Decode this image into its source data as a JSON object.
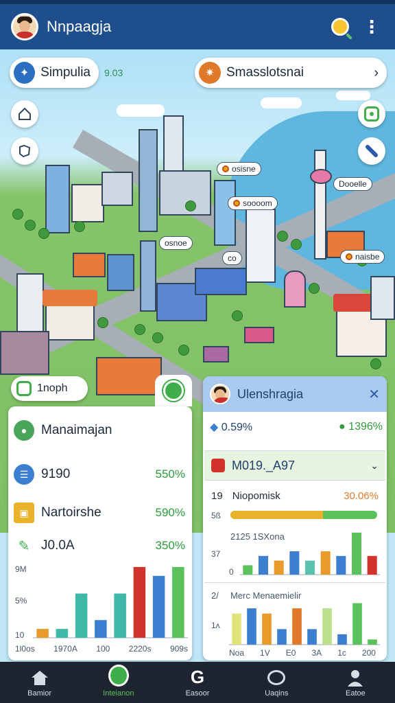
{
  "app": {
    "title": "Nnpaagja"
  },
  "search_chips": [
    {
      "label": "Simpulia",
      "extra": "9.03"
    },
    {
      "label": "Smasslotsnai"
    }
  ],
  "pins": [
    "osisne",
    "osnoe",
    "soooom",
    "co",
    "Dooelle",
    "naisbe"
  ],
  "left_panel": {
    "chip_label": "1noph",
    "title": "Manaimajan",
    "rows": [
      {
        "label": "9190",
        "value": "550%"
      },
      {
        "label": "Nartoirshe",
        "value": "590%"
      },
      {
        "label": "J0.0A",
        "value": "350%"
      }
    ],
    "y_ticks": [
      "9M",
      "5%",
      "10"
    ],
    "x_ticks": [
      "1l0os",
      "1970A",
      "100",
      "2220s",
      "909s"
    ]
  },
  "right_panel": {
    "title": "Ulenshragia",
    "stats": [
      {
        "label": "0.59%",
        "color": "#3c7fd0"
      },
      {
        "label": "1396%",
        "color": "#2e9a3c"
      }
    ],
    "select_value": "M019._A97",
    "progress": {
      "label": "Niopomisk",
      "number": "19",
      "value": "30.06%",
      "fraction": 0.63
    },
    "chart1": {
      "label": "2125 1SXona",
      "y_ticks": [
        "5ß",
        "37",
        "0"
      ]
    },
    "chart2": {
      "label": "Merc Menaemielir",
      "number": "2/",
      "y_tick": "1ʌ",
      "x_ticks": [
        "Noa",
        "1V",
        "E0",
        "3A",
        "1c",
        "200"
      ]
    }
  },
  "chart_data": [
    {
      "type": "bar",
      "categories": [
        "1l0os",
        "1970A",
        "100",
        "2220s",
        "909s"
      ],
      "series": [
        {
          "values": [
            1,
            1,
            5,
            2,
            5,
            8,
            7,
            8
          ],
          "colors": [
            "#e89a2a",
            "#3fb8a8",
            "#3fb8a8",
            "#3c7fd0",
            "#3fb8a8",
            "#d0332b",
            "#3c7fd0",
            "#5bc25b"
          ]
        }
      ]
    },
    {
      "type": "bar",
      "series": [
        {
          "values": [
            2,
            4,
            3,
            5,
            3,
            5,
            4,
            9,
            4
          ],
          "colors": [
            "#5bc25b",
            "#3c7fd0",
            "#e89a2a",
            "#3c7fd0",
            "#5bc2b0",
            "#e89a2a",
            "#3c7fd0",
            "#5bc25b",
            "#d0332b"
          ]
        }
      ]
    },
    {
      "type": "bar",
      "series": [
        {
          "values": [
            6,
            7,
            6,
            3,
            7,
            3,
            7,
            2,
            8,
            1
          ],
          "colors": [
            "#e2e27a",
            "#3c7fd0",
            "#e89a2a",
            "#3c7fd0",
            "#e07a2a",
            "#3c7fd0",
            "#b9e08a",
            "#3c7fd0",
            "#5bc25b",
            "#5bc25b"
          ]
        }
      ]
    }
  ],
  "bottom_nav": [
    {
      "label": "Bamior",
      "icon": "home-icon"
    },
    {
      "label": "Inteianon",
      "icon": "search-icon"
    },
    {
      "label": "Easoor",
      "icon": "g-icon"
    },
    {
      "label": "Uaqins",
      "icon": "chat-icon"
    },
    {
      "label": "Eatoe",
      "icon": "user-icon"
    }
  ]
}
